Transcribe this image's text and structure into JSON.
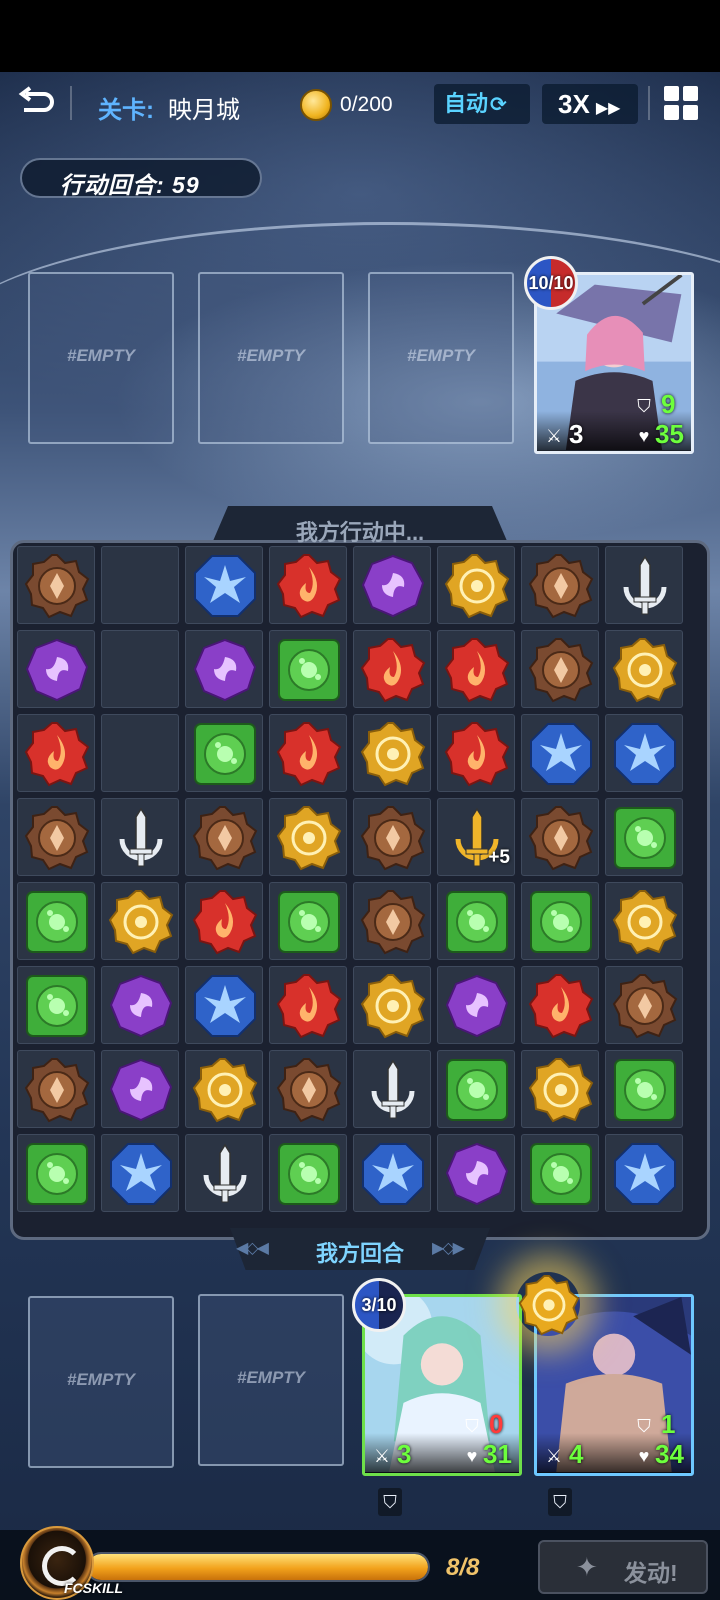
{
  "header": {
    "stage_label": "关卡:",
    "stage_name": "映月城",
    "coins": "0/200",
    "auto_label": "自动",
    "speed_label": "3X",
    "turns_label": "行动回合: 59"
  },
  "enemy": {
    "slots": [
      "#EMPTY",
      "#EMPTY",
      "#EMPTY"
    ],
    "card": {
      "badge": "10/10",
      "attack": "3",
      "defense": "9",
      "hp": "35"
    }
  },
  "board": {
    "title": "我方行动中...",
    "footer": "我方回合",
    "rows": [
      [
        "earth",
        "empty",
        "water",
        "fire",
        "dark",
        "light",
        "earth",
        "sword"
      ],
      [
        "dark",
        "empty",
        "dark",
        "wind",
        "fire",
        "fire",
        "earth",
        "light"
      ],
      [
        "fire",
        "empty",
        "wind",
        "fire",
        "light",
        "fire",
        "water",
        "water"
      ],
      [
        "earth",
        "sword",
        "earth",
        "light",
        "earth",
        "sword-gold",
        "earth",
        "wind"
      ],
      [
        "wind",
        "light",
        "fire",
        "wind",
        "earth",
        "wind",
        "wind",
        "light"
      ],
      [
        "wind",
        "dark",
        "water",
        "fire",
        "light",
        "dark",
        "fire",
        "earth"
      ],
      [
        "earth",
        "dark",
        "light",
        "earth",
        "sword",
        "wind",
        "light",
        "wind"
      ],
      [
        "wind",
        "water",
        "sword",
        "wind",
        "water",
        "dark",
        "wind",
        "water"
      ]
    ],
    "bonus_label": "+5"
  },
  "player": {
    "slots": [
      "#EMPTY",
      "#EMPTY"
    ],
    "cards": [
      {
        "badge": "3/10",
        "attack": "3",
        "defense": "0",
        "hp": "31"
      },
      {
        "attack": "4",
        "defense": "1",
        "hp": "34"
      }
    ]
  },
  "skill_bar": {
    "label": "FCSKILL",
    "energy": "8/8",
    "energy_fraction": 1.0,
    "launch_label": "发动!"
  },
  "colors": {
    "fire": "#d8312b",
    "water": "#2f63c9",
    "wind": "#3fae3a",
    "light": "#e0a524",
    "dark": "#8a3fc8",
    "earth": "#7a4a30",
    "accent": "#5fb4ff"
  }
}
